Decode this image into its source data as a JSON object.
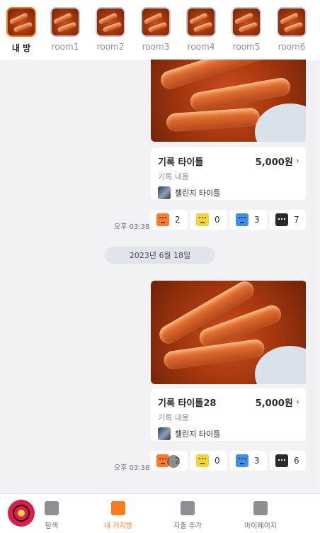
{
  "rooms": [
    {
      "label": "내 방",
      "active": true
    },
    {
      "label": "room1"
    },
    {
      "label": "room2"
    },
    {
      "label": "room3"
    },
    {
      "label": "room4"
    },
    {
      "label": "room5"
    },
    {
      "label": "room6"
    }
  ],
  "messages": [
    {
      "title": "기록 타이틀",
      "amount": "5,000원",
      "content": "기록 내용",
      "challenge": "챌린지 타이틀",
      "time": "오후 03:38",
      "reactions": {
        "angry": "2",
        "meh": "0",
        "sad": "3",
        "comments": "7"
      }
    },
    {
      "title": "기록 타이틀28",
      "amount": "5,000원",
      "content": "기록 내용",
      "challenge": "챌린지 타이틀",
      "time": "오후 03:38",
      "reactions": {
        "angry": "2",
        "meh": "0",
        "sad": "3",
        "comments": "6"
      }
    }
  ],
  "date_divider": "2023년 6월 18일",
  "chevron": "›",
  "nav": {
    "explore": "탐색",
    "my_room": "내 거지방",
    "add_expense": "지출 추가",
    "my_page": "마이페이지"
  },
  "colors": {
    "accent": "#ff7a1a",
    "angry": "#ff7a2a",
    "meh": "#f6d437",
    "sad": "#3d8fe8"
  },
  "icons": [
    "angry-face-icon",
    "neutral-face-icon",
    "sad-face-icon",
    "comment-icon",
    "compass-icon",
    "chat-icon",
    "add-expense-icon",
    "profile-icon"
  ]
}
